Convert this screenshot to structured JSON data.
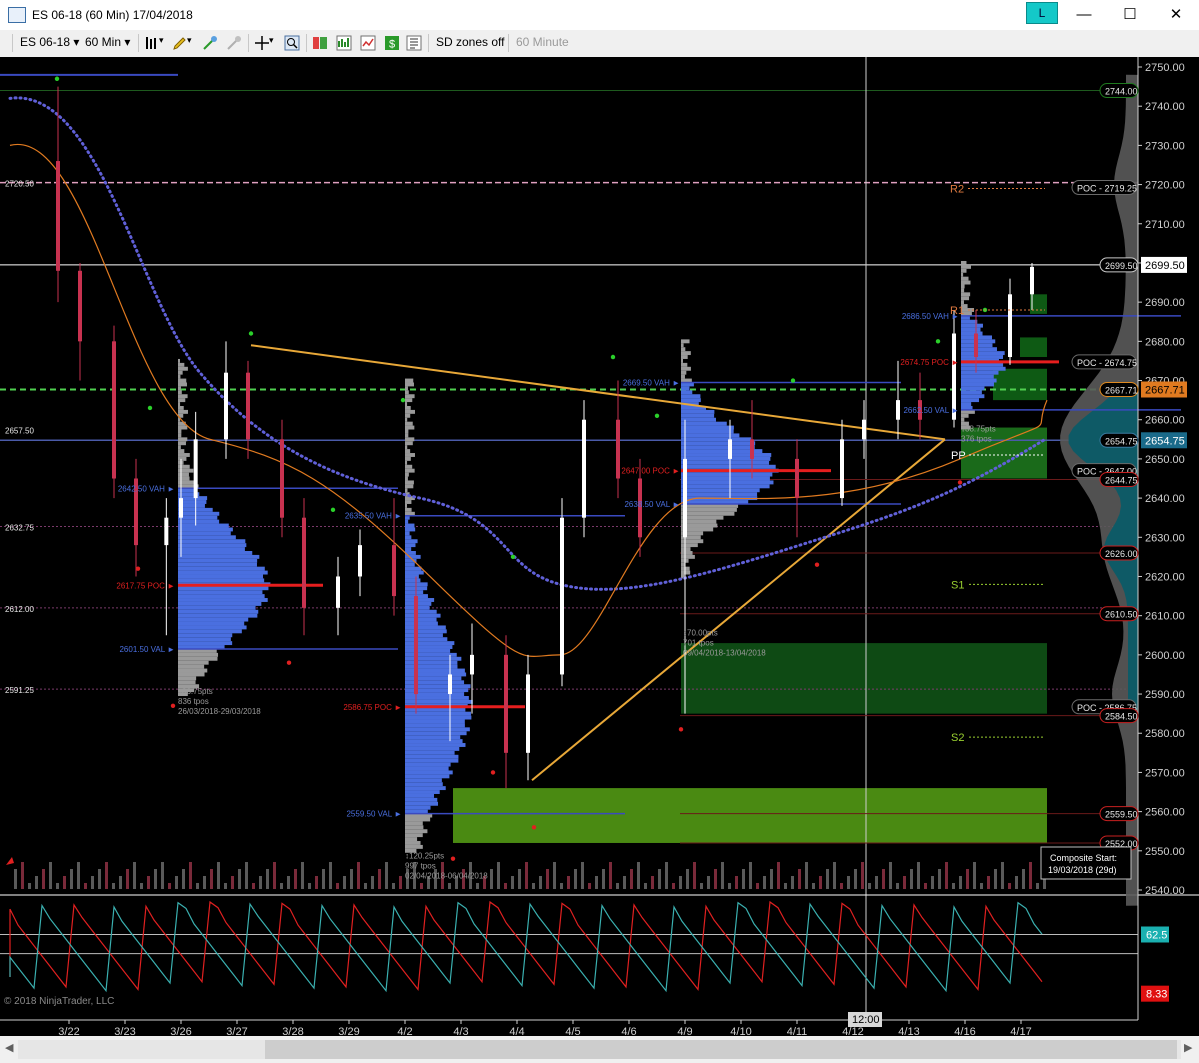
{
  "window": {
    "title": "ES 06-18 (60 Min)  17/04/2018",
    "link_button": "L",
    "minimize": "—",
    "maximize": "☐",
    "close": "✕"
  },
  "toolbar": {
    "instrument": "ES 06-18",
    "interval": "60 Min",
    "sd_zones": "SD zones off",
    "interval_label": "60 Minute"
  },
  "colors": {
    "background": "#000000",
    "candle_up": "#ffffff",
    "candle_down": "#c83250",
    "poc": "#e61e1e",
    "profile_blue": "#4a6fe0",
    "profile_gray": "#9a9a9a",
    "trendline": "#e8a838",
    "vwap_dotted": "#6060d8",
    "ma_orange": "#e07a20",
    "demand_zone": "#4a8a12",
    "zone_dark": "#0e4a14",
    "composite_teal": "#0e5a66"
  },
  "chart_data": {
    "type": "candlestick",
    "instrument": "ES 06-18",
    "interval": "60 Min",
    "date": "17/04/2018",
    "x_tick_labels": [
      "3/22",
      "3/23",
      "3/26",
      "3/27",
      "3/28",
      "3/29",
      "4/2",
      "4/3",
      "4/4",
      "4/5",
      "4/6",
      "4/9",
      "4/10",
      "4/11",
      "4/12",
      "4/13",
      "4/16",
      "4/17"
    ],
    "crosshair_label": "12:00",
    "y_ticks": [
      2540,
      2550,
      2560,
      2570,
      2580,
      2590,
      2600,
      2610,
      2620,
      2630,
      2640,
      2650,
      2660,
      2670,
      2680,
      2690,
      2700,
      2710,
      2720,
      2730,
      2740,
      2750
    ],
    "ylim": [
      2536,
      2754
    ],
    "ohlc": [
      [
        "3/22",
        2726,
        2745,
        2690,
        2698
      ],
      [
        "3/22",
        2698,
        2700,
        2670,
        2680
      ],
      [
        "3/23",
        2680,
        2684,
        2640,
        2645
      ],
      [
        "3/23",
        2645,
        2650,
        2620,
        2628
      ],
      [
        "3/26",
        2628,
        2640,
        2605,
        2635
      ],
      [
        "3/26",
        2635,
        2650,
        2625,
        2640
      ],
      [
        "3/26",
        2640,
        2662,
        2633,
        2655
      ],
      [
        "3/27",
        2655,
        2680,
        2650,
        2672
      ],
      [
        "3/27",
        2672,
        2675,
        2650,
        2655
      ],
      [
        "3/28",
        2655,
        2660,
        2630,
        2635
      ],
      [
        "3/28",
        2635,
        2640,
        2605,
        2612
      ],
      [
        "3/29",
        2612,
        2625,
        2605,
        2620
      ],
      [
        "3/29",
        2620,
        2632,
        2615,
        2628
      ],
      [
        "4/2",
        2628,
        2640,
        2610,
        2615
      ],
      [
        "4/2",
        2615,
        2620,
        2585,
        2590
      ],
      [
        "4/3",
        2590,
        2600,
        2578,
        2595
      ],
      [
        "4/3",
        2595,
        2608,
        2585,
        2600
      ],
      [
        "4/4",
        2600,
        2605,
        2566,
        2575
      ],
      [
        "4/4",
        2575,
        2600,
        2568,
        2595
      ],
      [
        "4/5",
        2595,
        2640,
        2592,
        2635
      ],
      [
        "4/5",
        2635,
        2665,
        2630,
        2660
      ],
      [
        "4/6",
        2660,
        2670,
        2640,
        2645
      ],
      [
        "4/6",
        2645,
        2650,
        2625,
        2630
      ],
      [
        "4/9",
        2630,
        2660,
        2585,
        2650
      ],
      [
        "4/10",
        2650,
        2660,
        2640,
        2655
      ],
      [
        "4/10",
        2655,
        2665,
        2645,
        2650
      ],
      [
        "4/11",
        2650,
        2655,
        2630,
        2640
      ],
      [
        "4/12",
        2640,
        2660,
        2638,
        2655
      ],
      [
        "4/12",
        2655,
        2665,
        2650,
        2660
      ],
      [
        "4/13",
        2660,
        2675,
        2655,
        2665
      ],
      [
        "4/13",
        2665,
        2672,
        2655,
        2660
      ],
      [
        "4/16",
        2660,
        2688,
        2658,
        2682
      ],
      [
        "4/16",
        2682,
        2688,
        2672,
        2676
      ],
      [
        "4/17",
        2676,
        2696,
        2674,
        2692
      ],
      [
        "4/17",
        2692,
        2700,
        2688,
        2699
      ]
    ],
    "last_price": "2699.50",
    "right_axis_labels": [
      {
        "text": "2744.00",
        "price": 2744,
        "color": "#1e7a1e"
      },
      {
        "text": "POC - 2719.25",
        "price": 2719.25,
        "color": "#6a6a6a"
      },
      {
        "text": "2699.50",
        "price": 2699.5,
        "color": "#c8c8c8"
      },
      {
        "text": "POC - 2674.75",
        "price": 2674.75,
        "color": "#6a6a6a"
      },
      {
        "text": "2667.71",
        "price": 2667.71,
        "color": "#e08a20"
      },
      {
        "text": "2654.75",
        "price": 2654.75,
        "color": "#3a7aa0"
      },
      {
        "text": "POC - 2647.00",
        "price": 2647,
        "color": "#6a6a6a"
      },
      {
        "text": "2644.75",
        "price": 2644.75,
        "color": "#c82020"
      },
      {
        "text": "2626.00",
        "price": 2626,
        "color": "#c82020"
      },
      {
        "text": "2610.50",
        "price": 2610.5,
        "color": "#c82020"
      },
      {
        "text": "POC - 2586.75",
        "price": 2586.75,
        "color": "#6a6a6a"
      },
      {
        "text": "2584.50",
        "price": 2584.5,
        "color": "#c82020"
      },
      {
        "text": "2559.50",
        "price": 2559.5,
        "color": "#c82020"
      },
      {
        "text": "2552.00",
        "price": 2552,
        "color": "#c82020"
      }
    ],
    "left_price_labels": [
      {
        "text": "2720.50",
        "price": 2720.5
      },
      {
        "text": "2657.50",
        "price": 2657.5
      },
      {
        "text": "2632.75",
        "price": 2632.75
      },
      {
        "text": "2612.00",
        "price": 2612
      },
      {
        "text": "2591.25",
        "price": 2591.25
      }
    ],
    "profile_labels": [
      {
        "text": "2617.75 POC ►",
        "price": 2617.75,
        "color": "#e02020"
      },
      {
        "text": "2601.50 VAL ►",
        "price": 2601.5,
        "color": "#4a6fe0"
      },
      {
        "text": "2642.50 VAH ►",
        "price": 2642.5,
        "color": "#4a6fe0"
      },
      {
        "text": "2635.50 VAH ►",
        "price": 2635.5,
        "color": "#4a6fe0"
      },
      {
        "text": "2586.75 POC ►",
        "price": 2586.75,
        "color": "#e02020"
      },
      {
        "text": "2559.50 VAL ►",
        "price": 2559.5,
        "color": "#4a6fe0"
      },
      {
        "text": "2669.50 VAH ►",
        "price": 2669.5,
        "color": "#4a6fe0"
      },
      {
        "text": "2647.00 POC ►",
        "price": 2647,
        "color": "#e02020"
      },
      {
        "text": "2638.50 VAL ►",
        "price": 2638.5,
        "color": "#4a6fe0"
      },
      {
        "text": "2686.50 VAH ►",
        "price": 2686.5,
        "color": "#4a6fe0"
      },
      {
        "text": "2674.75 POC ►",
        "price": 2674.75,
        "color": "#e02020"
      },
      {
        "text": "2662.50 VAL ►",
        "price": 2662.5,
        "color": "#4a6fe0"
      }
    ],
    "profile_stats": [
      {
        "lines": [
          "↕86.75pts",
          "836 tpos",
          "26/03/2018-29/03/2018"
        ]
      },
      {
        "lines": [
          "↕120.25pts",
          "997 tpos",
          "02/04/2018-06/04/2018"
        ]
      },
      {
        "lines": [
          "↕70.00pts",
          "701 tpos",
          "09/04/2018-13/04/2018"
        ]
      },
      {
        "lines": [
          "↕38.75pts",
          "376 tpos"
        ]
      }
    ],
    "pivots": [
      {
        "text": "R2",
        "price": 2719
      },
      {
        "text": "R1",
        "price": 2688
      },
      {
        "text": "PP",
        "price": 2651
      },
      {
        "text": "S1",
        "price": 2618
      },
      {
        "text": "S2",
        "price": 2579
      }
    ],
    "composite_box": [
      "Composite Start:",
      "19/03/2018 (29d)"
    ],
    "oscillator": {
      "levels": [
        62.5,
        8.33
      ],
      "label_upper": "62.5",
      "label_lower": "8.33"
    },
    "copyright": "© 2018 NinjaTrader, LLC"
  }
}
